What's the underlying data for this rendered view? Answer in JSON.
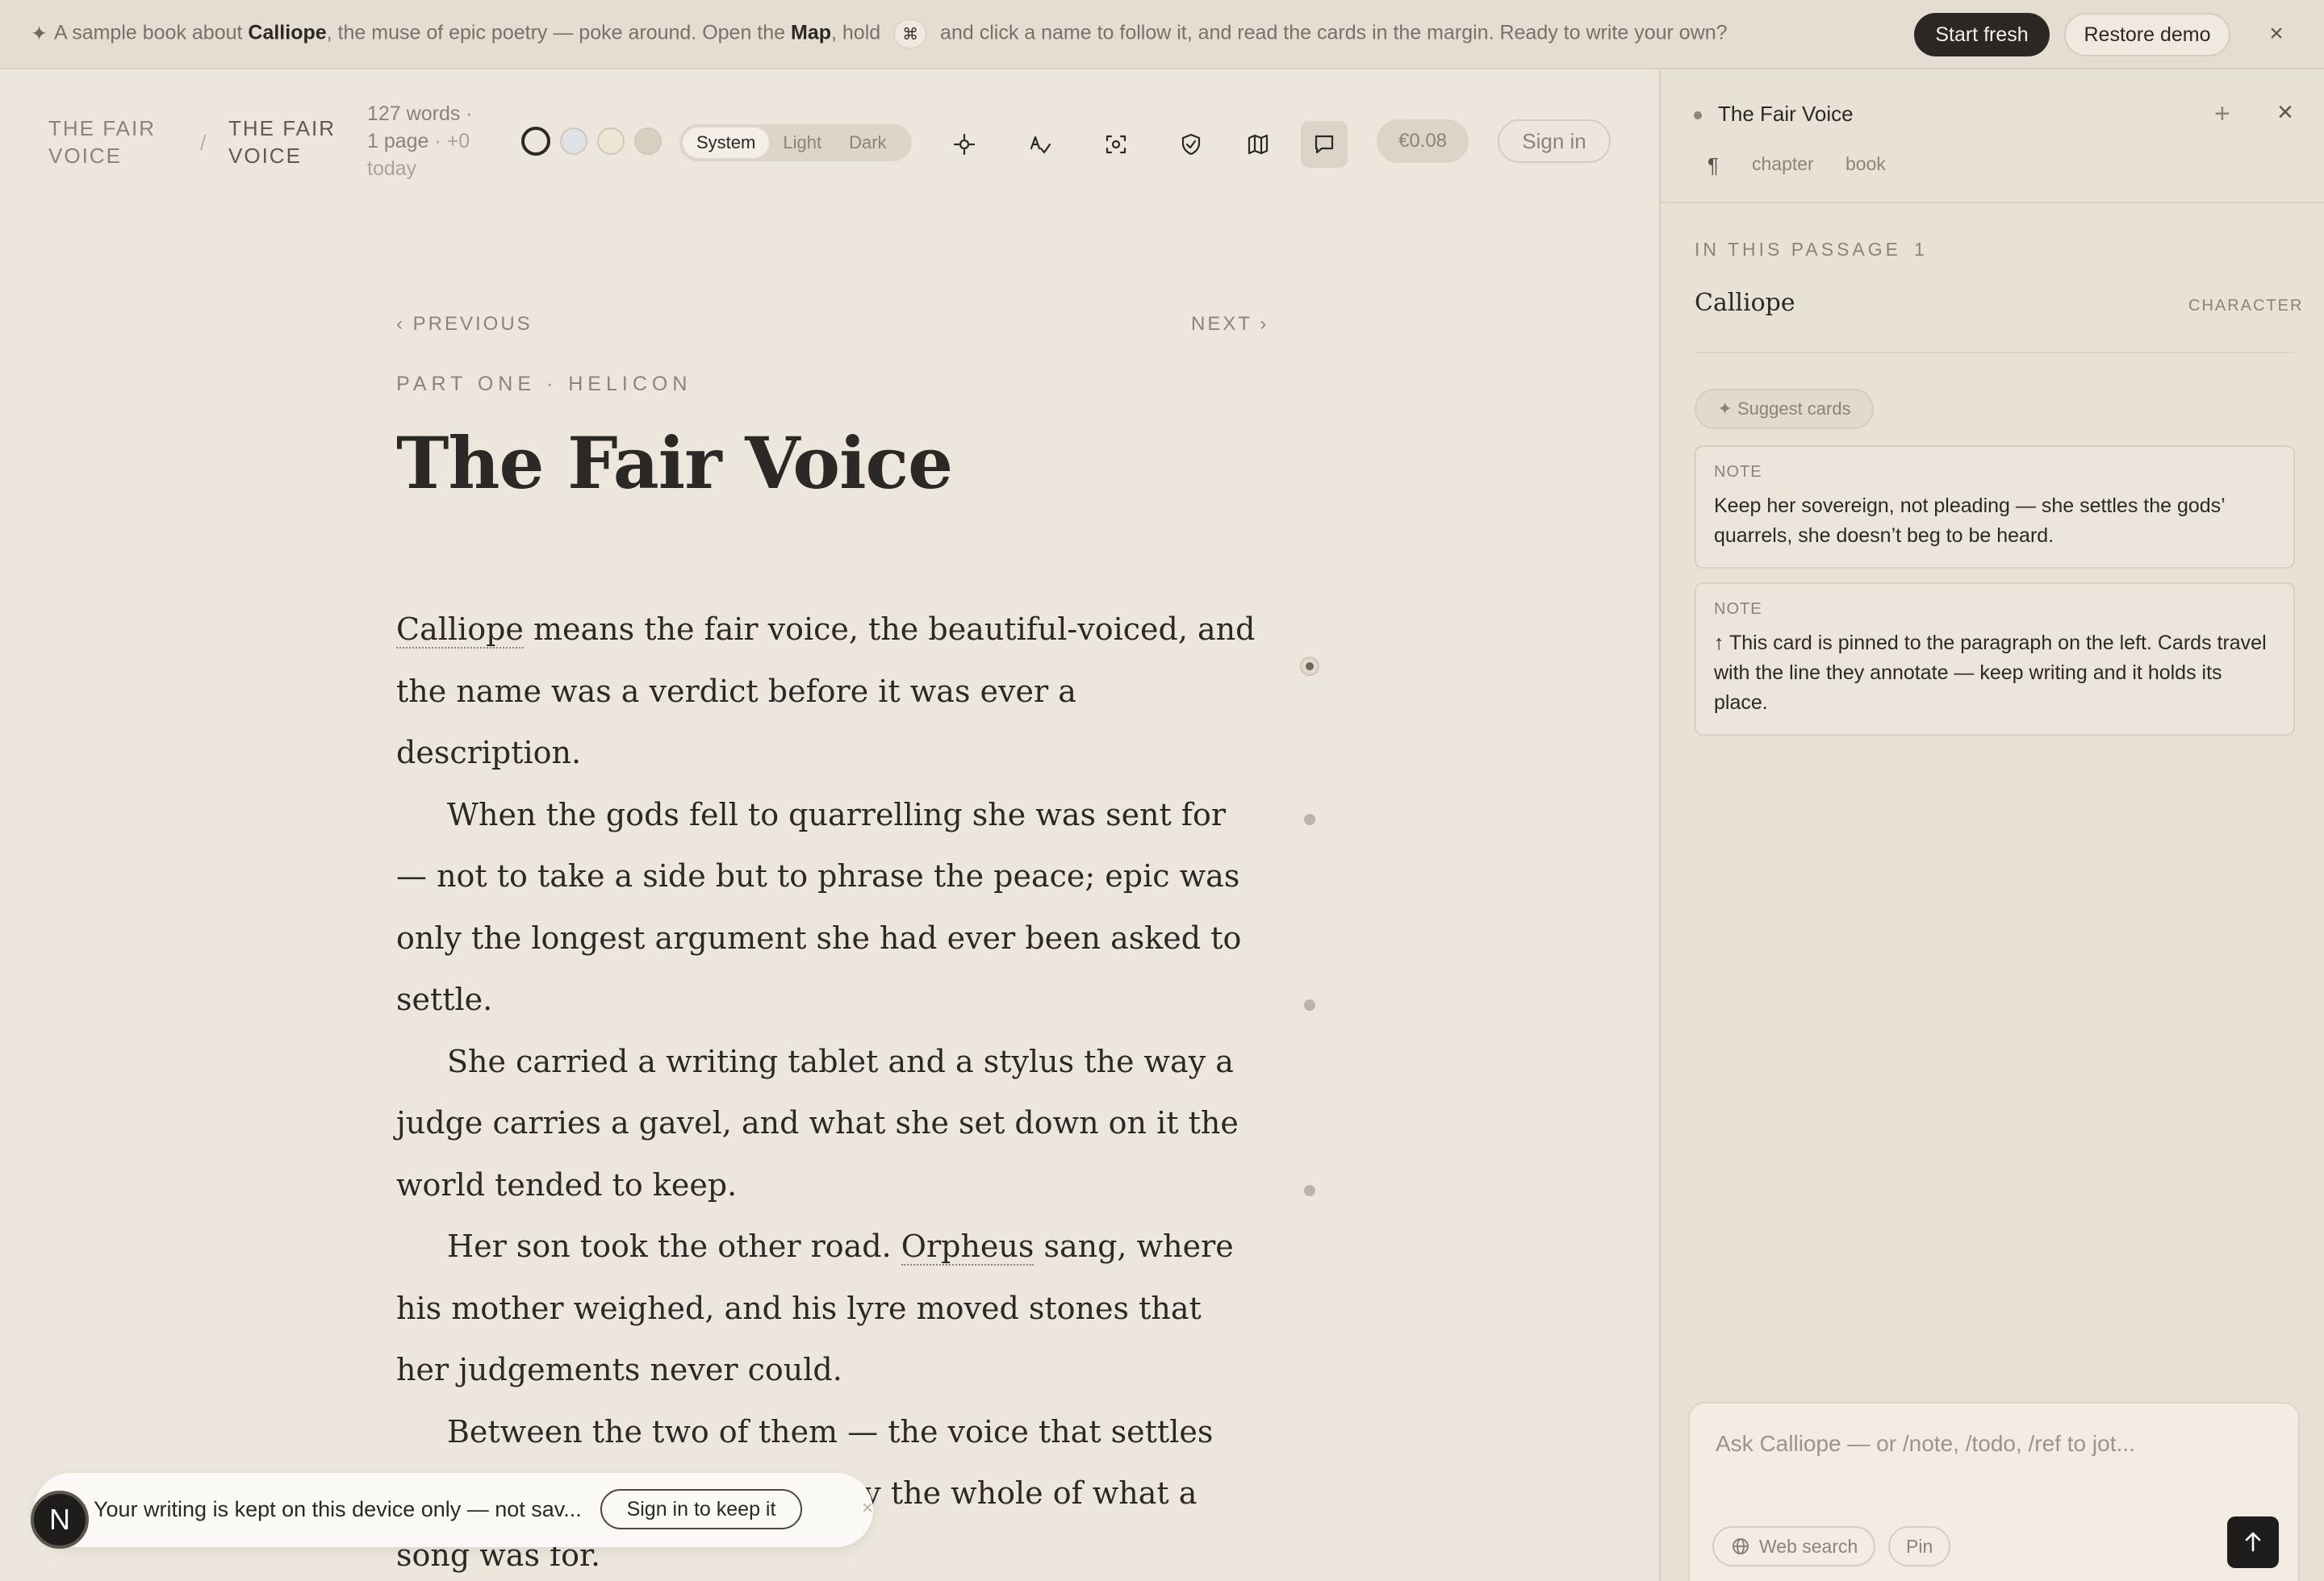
{
  "banner": {
    "spark": "✦",
    "text_1": "A sample book about ",
    "bold_1": "Calliope",
    "text_2": ", the muse of epic poetry — poke around. Open the ",
    "bold_2": "Map",
    "text_3": ", hold ",
    "kbd": "⌘",
    "text_4": " and click a name to follow it, and read the cards in the margin. Ready to write your own?",
    "start_fresh": "Start fresh",
    "restore_demo": "Restore demo",
    "close": "×"
  },
  "toolbar": {
    "crumb_book": "THE FAIR VOICE",
    "crumb_sep": "/",
    "crumb_chapter": "THE FAIR VOICE",
    "stats_words": "127 words ·",
    "stats_pages": "1 page",
    "stats_today_a": " · +0",
    "stats_today_b": "today",
    "swatches": [
      "#ece6dc",
      "#e0e3e6",
      "#efe6d2",
      "#d9d0c0"
    ],
    "theme": {
      "system": "System",
      "light": "Light",
      "dark": "Dark",
      "selected": "System"
    },
    "tools": [
      "focus-icon",
      "spellcheck-icon",
      "capture-icon",
      "shield-icon",
      "map-icon",
      "comment-icon"
    ],
    "price": "€0.08",
    "sign_in": "Sign in"
  },
  "editor": {
    "prev": "‹ PREVIOUS",
    "next": "NEXT ›",
    "part": "PART ONE · HELICON",
    "title": "The Fair Voice",
    "p1_link": "Calliope",
    "p1_rest": " means the fair voice, the beautiful-voiced, and the name was a verdict before it was ever a description.",
    "p2": "When the gods fell to quarrelling she was sent for — not to take a side but to phrase the peace; epic was only the longest argument she had ever been asked to settle.",
    "p3": "She carried a writing tablet and a stylus the way a judge carries a gavel, and what she set down on it the world tended to keep.",
    "p4_a": "Her son took the other road. ",
    "p4_link": "Orpheus",
    "p4_b": " sang, where his mother weighed, and his lyre moved stones that her judgements never could.",
    "p5": "Between the two of them — the voice that settles and the voice that moves — lay the whole of what a song was for."
  },
  "toast": {
    "avatar": "N",
    "message": "Your writing is kept on this device only — not sav...",
    "keep": "Sign in to keep it",
    "close": "×"
  },
  "panel": {
    "title": "The Fair Voice",
    "plus": "+",
    "close": "×",
    "scope_pilcrow": "¶",
    "scope_chapter": "chapter",
    "scope_book": "book",
    "section": "IN THIS PASSAGE",
    "section_count": "1",
    "entity_name": "Calliope",
    "entity_type": "CHARACTER",
    "suggest": "✦ Suggest cards",
    "cards": [
      {
        "label": "NOTE",
        "text": "Keep her sovereign, not pleading — she settles the gods’ quarrels, she doesn’t beg to be heard."
      },
      {
        "label": "NOTE",
        "text": "↑ This card is pinned to the paragraph on the left. Cards travel with the line they annotate — keep writing and it holds its place."
      }
    ],
    "composer_placeholder": "Ask Calliope — or /note, /todo, /ref to jot...",
    "web_search": "Web search",
    "pin": "Pin"
  }
}
